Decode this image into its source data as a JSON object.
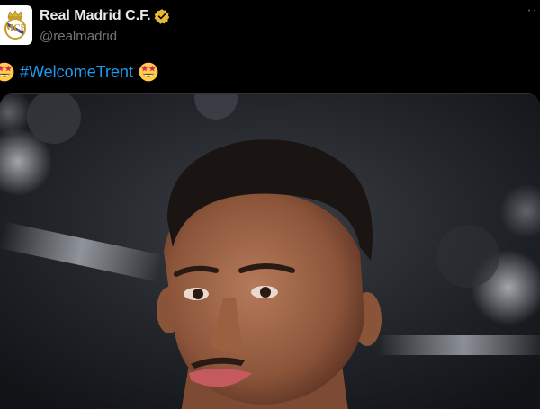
{
  "account": {
    "display_name": "Real Madrid C.F.",
    "handle": "@realmadrid",
    "verified_badge": "verified-gold-badge-icon",
    "avatar_icon": "real-madrid-crest-icon"
  },
  "more_menu": {
    "icon": "more-options-icon",
    "glyph": "··"
  },
  "tweet": {
    "hashtag": "#WelcomeTrent",
    "emoji_left": "star-struck-emoji",
    "emoji_right": "star-struck-emoji"
  },
  "media": {
    "kind": "photo",
    "icon": "player-portrait-photo"
  },
  "colors": {
    "background": "#000000",
    "name": "#e7e9ea",
    "handle": "#71767b",
    "hashtag": "#1d9bf0",
    "verified": "#e8b730"
  }
}
